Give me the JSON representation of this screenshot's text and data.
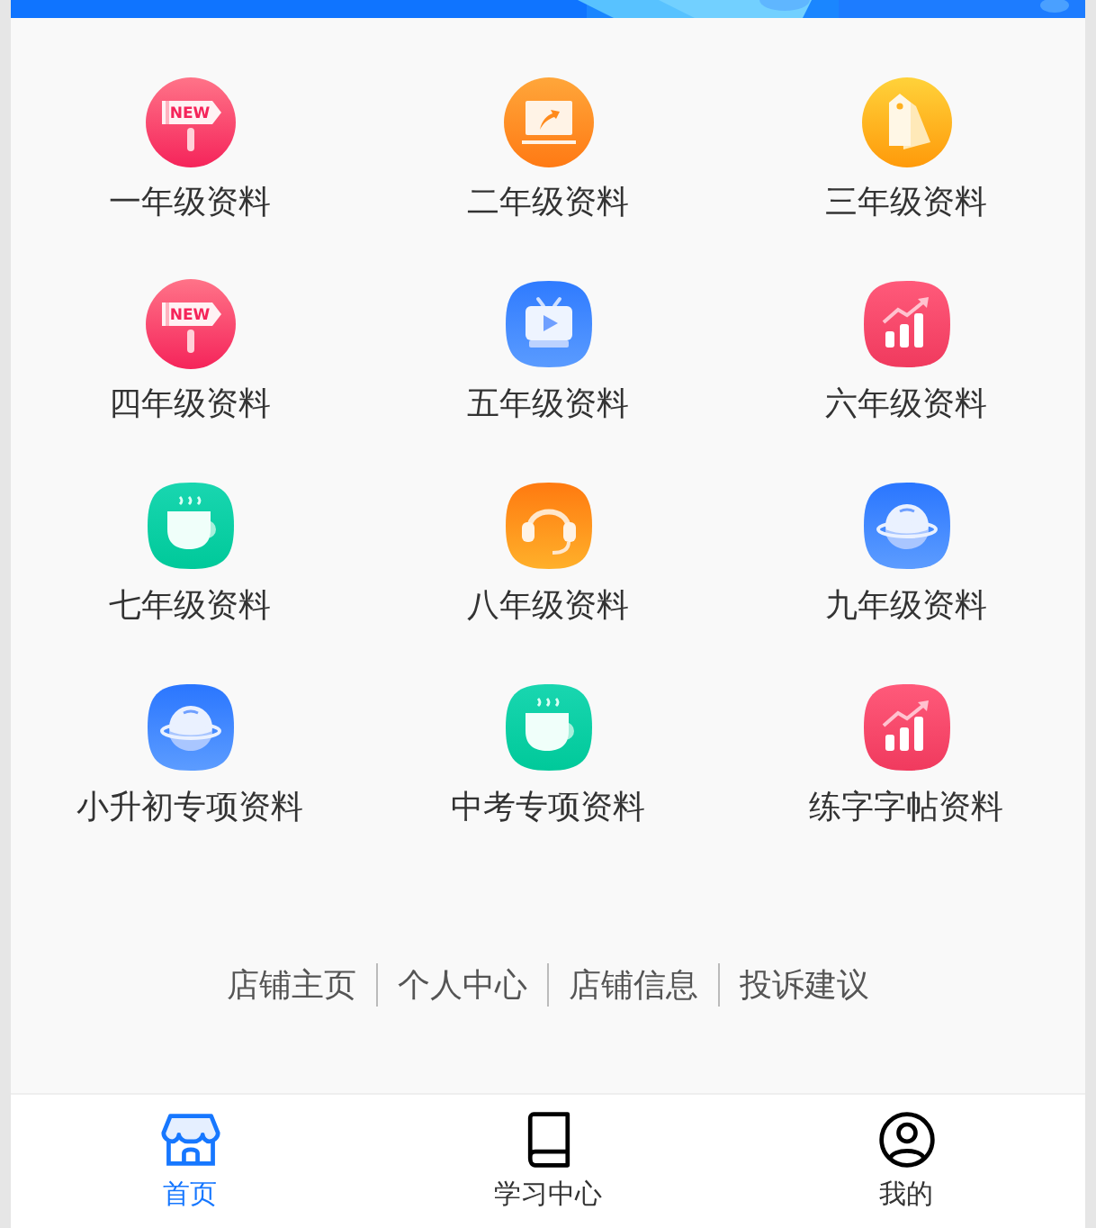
{
  "grid": [
    {
      "label": "一年级资料",
      "kind": "sign",
      "icon_text": "NEW"
    },
    {
      "label": "二年级资料",
      "kind": "laptop"
    },
    {
      "label": "三年级资料",
      "kind": "tag"
    },
    {
      "label": "四年级资料",
      "kind": "sign",
      "icon_text": "NEW"
    },
    {
      "label": "五年级资料",
      "kind": "tv"
    },
    {
      "label": "六年级资料",
      "kind": "chart"
    },
    {
      "label": "七年级资料",
      "kind": "cup"
    },
    {
      "label": "八年级资料",
      "kind": "headset"
    },
    {
      "label": "九年级资料",
      "kind": "planet"
    },
    {
      "label": "小升初专项资料",
      "kind": "planet"
    },
    {
      "label": "中考专项资料",
      "kind": "cup"
    },
    {
      "label": "练字字帖资料",
      "kind": "chart"
    }
  ],
  "footer_links": [
    "店铺主页",
    "个人中心",
    "店铺信息",
    "投诉建议"
  ],
  "tab_bar": [
    {
      "label": "首页",
      "kind": "store",
      "selected": true
    },
    {
      "label": "学习中心",
      "kind": "book",
      "selected": false
    },
    {
      "label": "我的",
      "kind": "user",
      "selected": false
    }
  ]
}
